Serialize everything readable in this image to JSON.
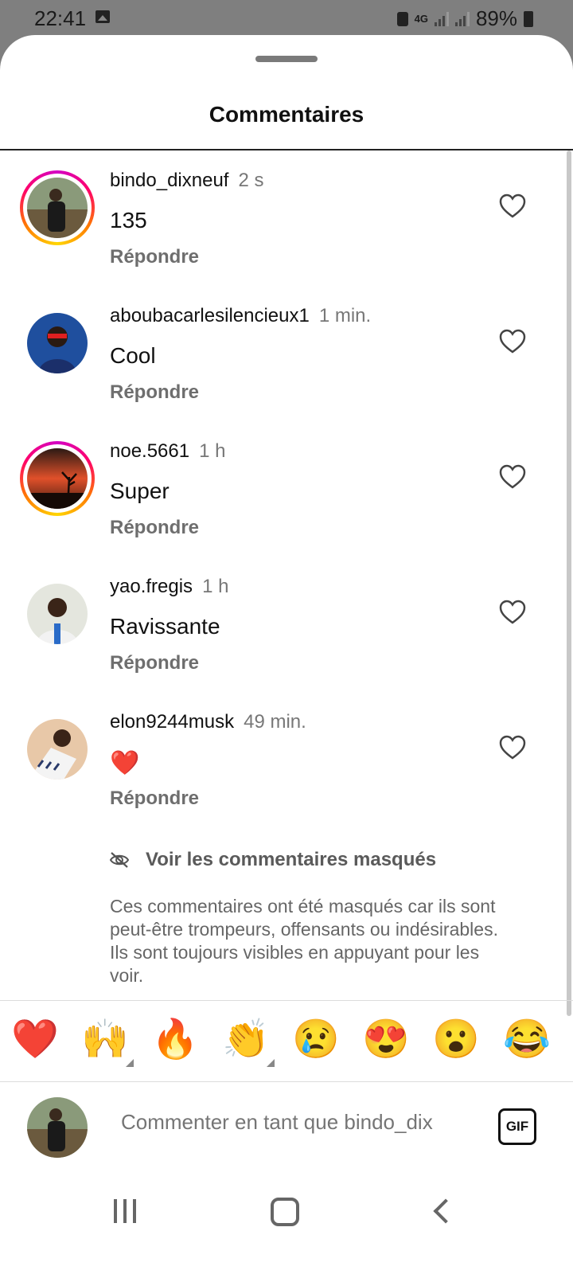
{
  "status_bar": {
    "time": "22:41",
    "network": "4G",
    "battery": "89%"
  },
  "sheet": {
    "title": "Commentaires"
  },
  "comments": [
    {
      "username": "bindo_dixneuf",
      "time": "2 s",
      "text": "135",
      "reply": "Répondre",
      "story_ring": true,
      "avatar_color": "#6b7a5e"
    },
    {
      "username": "aboubacarlesilencieux1",
      "time": "1 min.",
      "text": "Cool",
      "reply": "Répondre",
      "story_ring": false,
      "avatar_color": "#1f4f9e"
    },
    {
      "username": "noe.5661",
      "time": "1 h",
      "text": "Super",
      "reply": "Répondre",
      "story_ring": true,
      "avatar_color": "#c4451e"
    },
    {
      "username": "yao.fregis",
      "time": "1 h",
      "text": "Ravissante",
      "reply": "Répondre",
      "story_ring": false,
      "avatar_color": "#d9dcd2"
    },
    {
      "username": "elon9244musk",
      "time": "49 min.",
      "text": "❤️",
      "reply": "Répondre",
      "story_ring": false,
      "avatar_color": "#c88a5a"
    }
  ],
  "hidden_comments": {
    "link": "Voir les commentaires masqués",
    "info": "Ces commentaires ont été masqués car ils sont peut-être trompeurs, offensants ou indésirables. Ils sont toujours visibles en appuyant pour les voir."
  },
  "emoji_reactions": [
    "❤️",
    "🙌",
    "🔥",
    "👏",
    "😢",
    "😍",
    "😮",
    "😂"
  ],
  "composer": {
    "placeholder": "Commenter en tant que bindo_dix",
    "gif_label": "GIF"
  },
  "colors": {
    "story_ring_start": "#d300c5",
    "story_ring_end": "#ffd600",
    "heart_red": "#ed1c24"
  }
}
